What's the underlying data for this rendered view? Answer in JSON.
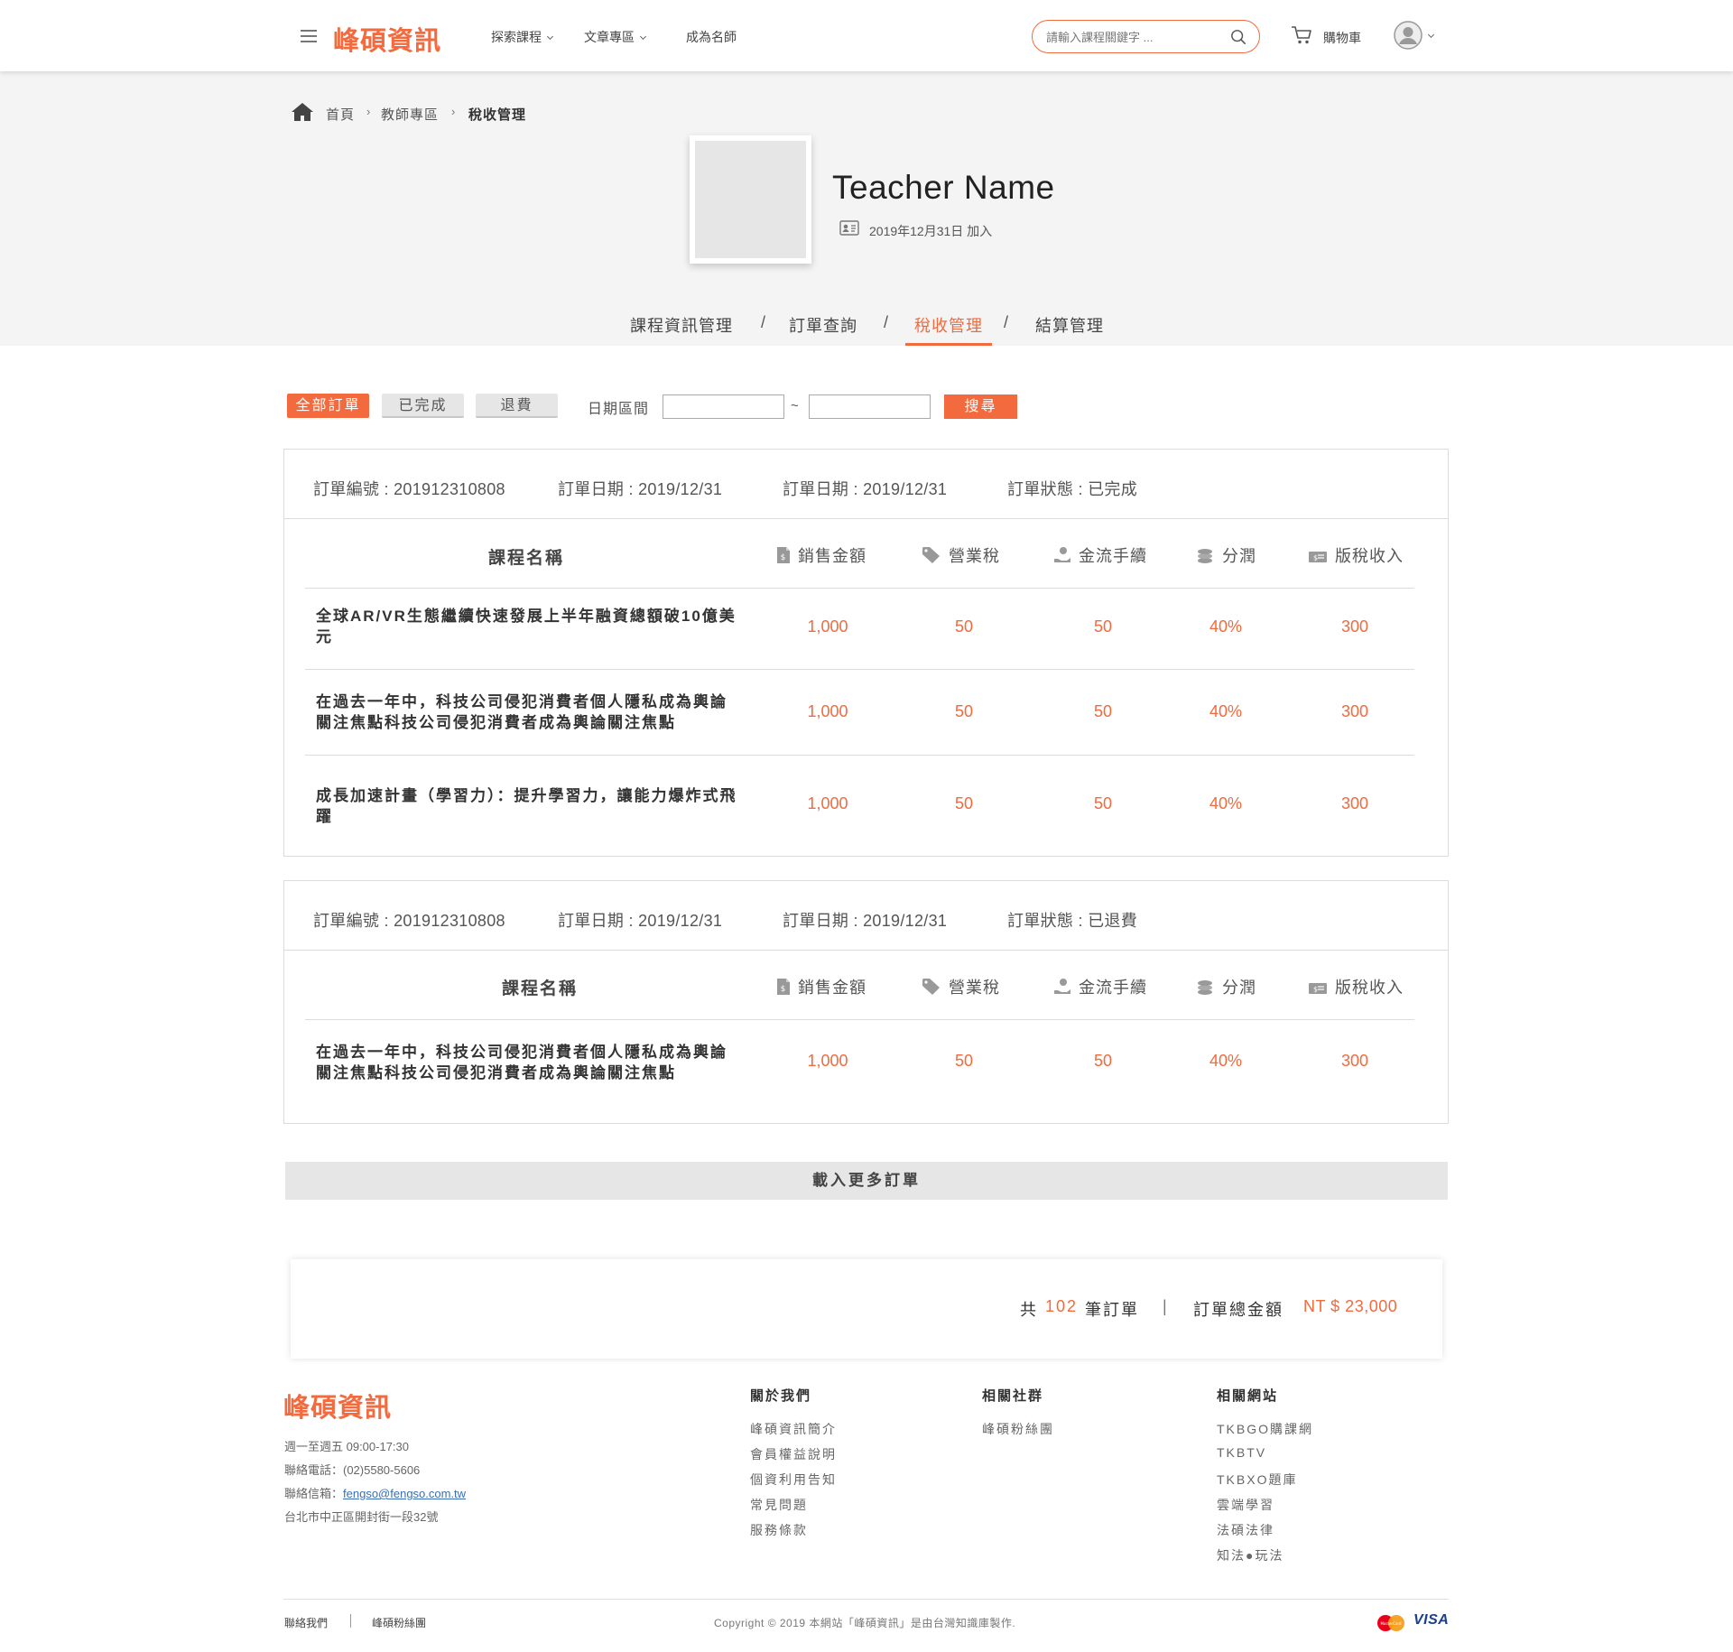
{
  "header": {
    "logo": "峰碩資訊",
    "nav": [
      "探索課程",
      "文章專區",
      "成為名師"
    ],
    "search_placeholder": "請輸入課程關鍵字 ...",
    "cart_label": "購物車"
  },
  "breadcrumb": [
    "首頁",
    "教師專區",
    "稅收管理"
  ],
  "teacher": {
    "name": "Teacher Name",
    "joined": "2019年12月31日 加入"
  },
  "tabs": [
    "課程資訊管理",
    "訂單查詢",
    "稅收管理",
    "結算管理"
  ],
  "tab_separator": "/",
  "active_tab": "稅收管理",
  "filters": {
    "buttons": [
      "全部訂單",
      "已完成",
      "退費"
    ],
    "date_label": "日期區間",
    "date_from": "",
    "date_to": "",
    "tilde": "~",
    "search_label": "搜尋"
  },
  "columns": {
    "course": "課程名稱",
    "sales": "銷售金額",
    "tax": "營業稅",
    "fee": "金流手續",
    "share": "分潤",
    "royalty": "版稅收入"
  },
  "orders": [
    {
      "number": "訂單編號 : 201912310808",
      "date1": "訂單日期 : 2019/12/31",
      "date2": "訂單日期 : 2019/12/31",
      "status": "訂單狀態 : 已完成",
      "rows": [
        {
          "course": "全球AR/VR生態繼續快速發展上半年融資總額破10億美元",
          "sales": "1,000",
          "tax": "50",
          "fee": "50",
          "share": "40%",
          "royalty": "300"
        },
        {
          "course": "在過去一年中，科技公司侵犯消費者個人隱私成為輿論關注焦點科技公司侵犯消費者成為輿論關注焦點",
          "sales": "1,000",
          "tax": "50",
          "fee": "50",
          "share": "40%",
          "royalty": "300"
        },
        {
          "course": "成長加速計畫（學習力）：提升學習力，讓能力爆炸式飛躍",
          "sales": "1,000",
          "tax": "50",
          "fee": "50",
          "share": "40%",
          "royalty": "300"
        }
      ]
    },
    {
      "number": "訂單編號 : 201912310808",
      "date1": "訂單日期 : 2019/12/31",
      "date2": "訂單日期 : 2019/12/31",
      "status": "訂單狀態 : 已退費",
      "rows": [
        {
          "course": "在過去一年中，科技公司侵犯消費者個人隱私成為輿論關注焦點科技公司侵犯消費者成為輿論關注焦點",
          "sales": "1,000",
          "tax": "50",
          "fee": "50",
          "share": "40%",
          "royalty": "300"
        }
      ]
    }
  ],
  "load_more": "載入更多訂單",
  "summary": {
    "prefix": "共",
    "count": "102",
    "suffix": "筆訂單",
    "divider": "|",
    "total_label": "訂單總金額",
    "total_value": "NT $ 23,000"
  },
  "footer": {
    "logo": "峰碩資訊",
    "hours": "週一至週五  09:00-17:30",
    "phone": "聯絡電話：(02)5580-5606",
    "email_label": "聯絡信箱：",
    "email": "fengso@fengso.com.tw",
    "address": "台北市中正區開封街一段32號",
    "columns": [
      {
        "title": "關於我們",
        "links": [
          "峰碩資訊簡介",
          "會員權益說明",
          "個資利用告知",
          "常見問題",
          "服務條款"
        ]
      },
      {
        "title": "相關社群",
        "links": [
          "峰碩粉絲團"
        ]
      },
      {
        "title": "相關網站",
        "links": [
          "TKBGO購課網",
          "TKBTV",
          "TKBXO題庫",
          "雲端學習",
          "法碩法律",
          "知法●玩法"
        ]
      }
    ],
    "bottom_links": [
      "聯絡我們",
      "峰碩粉絲團"
    ],
    "copyright": "Copyright © 2019 本網站「峰碩資訊」是由台灣知識庫製作.",
    "payment": [
      "MasterCard",
      "VISA"
    ]
  },
  "colors": {
    "accent": "#f26a3d",
    "band": "#f4f4f4",
    "border": "#dcdcdc"
  }
}
